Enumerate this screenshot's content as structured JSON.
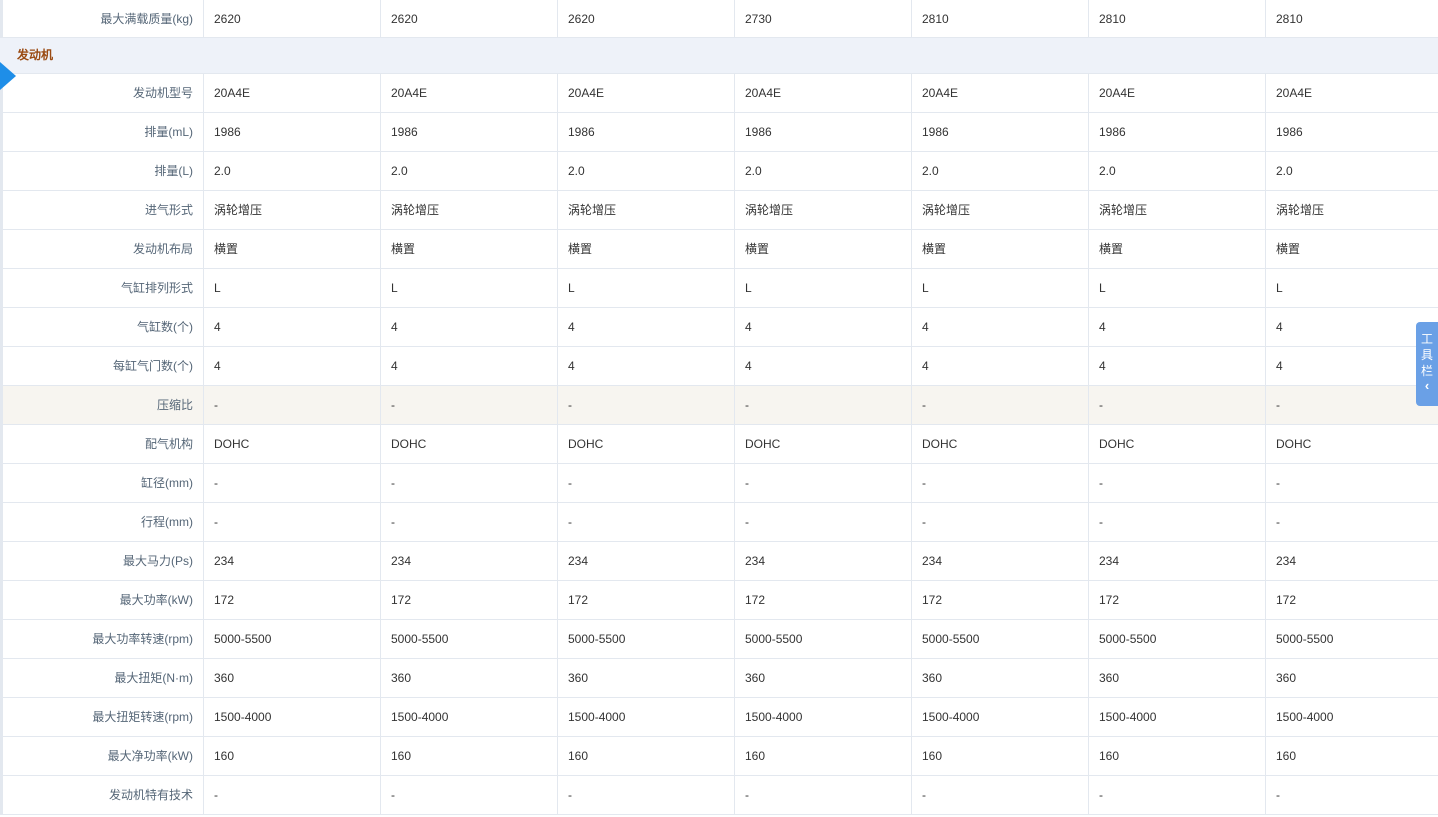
{
  "first_row": {
    "label": "最大满载质量(kg)",
    "values": [
      "2620",
      "2620",
      "2620",
      "2730",
      "2810",
      "2810",
      "2810"
    ]
  },
  "section": {
    "title": "发动机"
  },
  "rows": [
    {
      "label": "发动机型号",
      "values": [
        "20A4E",
        "20A4E",
        "20A4E",
        "20A4E",
        "20A4E",
        "20A4E",
        "20A4E"
      ]
    },
    {
      "label": "排量(mL)",
      "values": [
        "1986",
        "1986",
        "1986",
        "1986",
        "1986",
        "1986",
        "1986"
      ]
    },
    {
      "label": "排量(L)",
      "values": [
        "2.0",
        "2.0",
        "2.0",
        "2.0",
        "2.0",
        "2.0",
        "2.0"
      ]
    },
    {
      "label": "进气形式",
      "values": [
        "涡轮增压",
        "涡轮增压",
        "涡轮增压",
        "涡轮增压",
        "涡轮增压",
        "涡轮增压",
        "涡轮增压"
      ]
    },
    {
      "label": "发动机布局",
      "values": [
        "横置",
        "横置",
        "横置",
        "横置",
        "横置",
        "横置",
        "横置"
      ]
    },
    {
      "label": "气缸排列形式",
      "values": [
        "L",
        "L",
        "L",
        "L",
        "L",
        "L",
        "L"
      ]
    },
    {
      "label": "气缸数(个)",
      "values": [
        "4",
        "4",
        "4",
        "4",
        "4",
        "4",
        "4"
      ]
    },
    {
      "label": "每缸气门数(个)",
      "values": [
        "4",
        "4",
        "4",
        "4",
        "4",
        "4",
        "4"
      ]
    },
    {
      "label": "压缩比",
      "values": [
        "-",
        "-",
        "-",
        "-",
        "-",
        "-",
        "-"
      ],
      "shaded": true
    },
    {
      "label": "配气机构",
      "values": [
        "DOHC",
        "DOHC",
        "DOHC",
        "DOHC",
        "DOHC",
        "DOHC",
        "DOHC"
      ]
    },
    {
      "label": "缸径(mm)",
      "values": [
        "-",
        "-",
        "-",
        "-",
        "-",
        "-",
        "-"
      ]
    },
    {
      "label": "行程(mm)",
      "values": [
        "-",
        "-",
        "-",
        "-",
        "-",
        "-",
        "-"
      ]
    },
    {
      "label": "最大马力(Ps)",
      "values": [
        "234",
        "234",
        "234",
        "234",
        "234",
        "234",
        "234"
      ]
    },
    {
      "label": "最大功率(kW)",
      "values": [
        "172",
        "172",
        "172",
        "172",
        "172",
        "172",
        "172"
      ]
    },
    {
      "label": "最大功率转速(rpm)",
      "values": [
        "5000-5500",
        "5000-5500",
        "5000-5500",
        "5000-5500",
        "5000-5500",
        "5000-5500",
        "5000-5500"
      ]
    },
    {
      "label": "最大扭矩(N·m)",
      "values": [
        "360",
        "360",
        "360",
        "360",
        "360",
        "360",
        "360"
      ]
    },
    {
      "label": "最大扭矩转速(rpm)",
      "values": [
        "1500-4000",
        "1500-4000",
        "1500-4000",
        "1500-4000",
        "1500-4000",
        "1500-4000",
        "1500-4000"
      ]
    },
    {
      "label": "最大净功率(kW)",
      "values": [
        "160",
        "160",
        "160",
        "160",
        "160",
        "160",
        "160"
      ]
    },
    {
      "label": "发动机特有技术",
      "values": [
        "-",
        "-",
        "-",
        "-",
        "-",
        "-",
        "-"
      ]
    }
  ],
  "toolbar": {
    "chars": [
      "工",
      "具",
      "栏"
    ],
    "chevron": "‹"
  },
  "colors": {
    "accent": "#1e8ee8",
    "section_title": "#9a4a12",
    "toolbar_bg": "#6aa0e6"
  }
}
